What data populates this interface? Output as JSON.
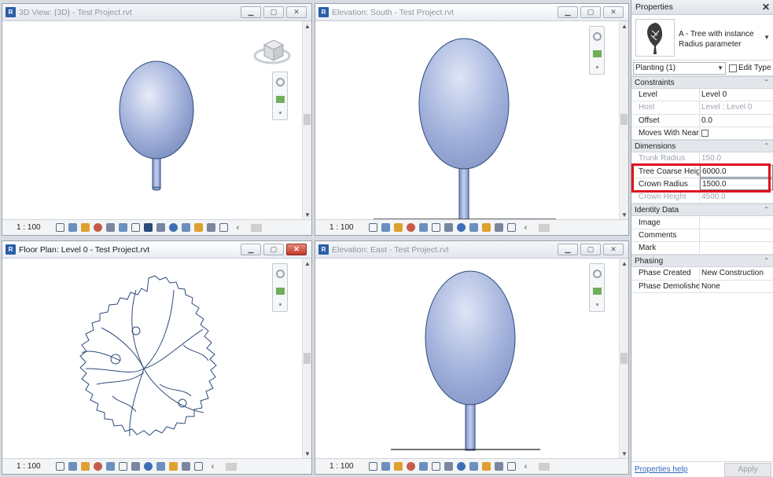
{
  "views": {
    "view3d": {
      "title": "3D View: {3D} - Test Project.rvt",
      "scale": "1 : 100"
    },
    "south": {
      "title": "Elevation: South - Test Project.rvt",
      "scale": "1 : 100"
    },
    "plan": {
      "title": "Floor Plan: Level 0 - Test Project.rvt",
      "scale": "1 : 100"
    },
    "east": {
      "title": "Elevation: East - Test Project.rvt",
      "scale": "1 : 100"
    }
  },
  "window_buttons": {
    "minimize": "▁",
    "restore": "▢",
    "close": "✕"
  },
  "properties": {
    "header": "Properties",
    "close": "✕",
    "type_name": "A - Tree with instance Radius parameter",
    "filter": "Planting (1)",
    "edit_type": "Edit Type",
    "groups": {
      "constraints": "Constraints",
      "dimensions": "Dimensions",
      "identity": "Identity Data",
      "phasing": "Phasing"
    },
    "constraints": [
      {
        "key": "Level",
        "value": "Level 0"
      },
      {
        "key": "Host",
        "value": "Level : Level 0"
      },
      {
        "key": "Offset",
        "value": "0.0"
      },
      {
        "key": "Moves With Near...",
        "value": ""
      }
    ],
    "dimensions": [
      {
        "key": "Trunk Radius",
        "value": "150.0"
      },
      {
        "key": "Tree Coarse Height",
        "value": "6000.0"
      },
      {
        "key": "Crown Radius",
        "value": "1500.0"
      },
      {
        "key": "Crown Height",
        "value": "4500.0"
      }
    ],
    "identity": [
      {
        "key": "Image",
        "value": ""
      },
      {
        "key": "Comments",
        "value": ""
      },
      {
        "key": "Mark",
        "value": ""
      }
    ],
    "phasing": [
      {
        "key": "Phase Created",
        "value": "New Construction"
      },
      {
        "key": "Phase Demolished",
        "value": "None"
      }
    ],
    "help": "Properties help",
    "apply": "Apply"
  },
  "colors": {
    "highlight": "#e1111f",
    "crown": "#a3b3dc",
    "outline": "#2c4a7a"
  }
}
